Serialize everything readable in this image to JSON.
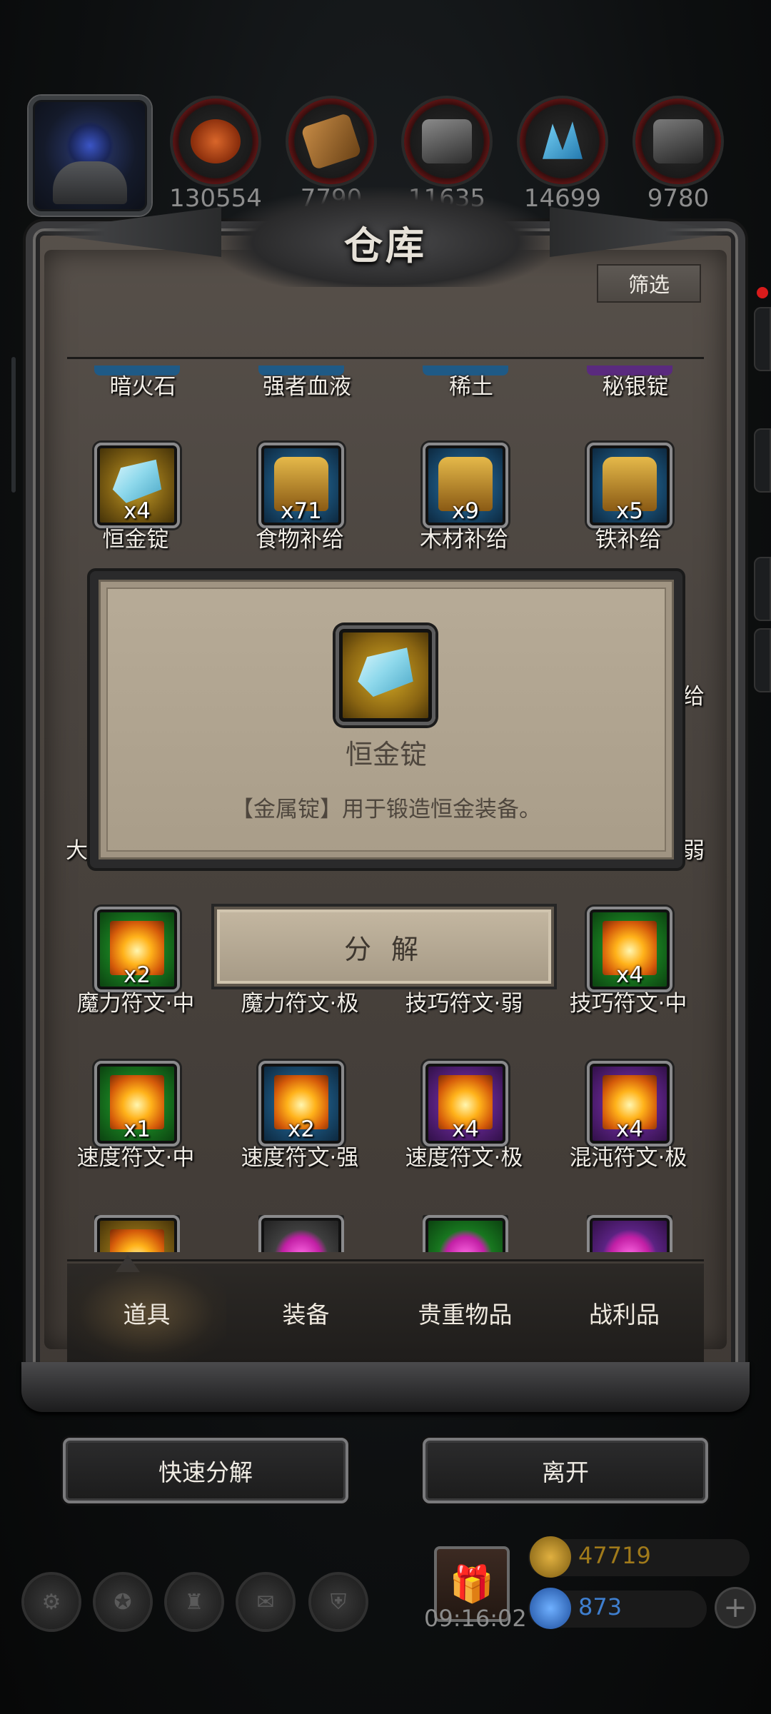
{
  "resources": [
    {
      "icon": "orb-icon",
      "count": "130554",
      "color": "#c24a17"
    },
    {
      "icon": "wood-icon",
      "count": "7790",
      "color": "#9a6a2e"
    },
    {
      "icon": "iron-icon",
      "count": "11635",
      "color": "#6a6a6a"
    },
    {
      "icon": "crystal-icon",
      "count": "14699",
      "color": "#2fa6d8"
    },
    {
      "icon": "steel-icon",
      "count": "9780",
      "color": "#5e5e5e"
    }
  ],
  "panel": {
    "title": "仓库",
    "filter_label": "筛选"
  },
  "rows": {
    "partial_names": [
      "暗火石",
      "强者血液",
      "稀土",
      "秘银锭"
    ],
    "row1": [
      {
        "name": "恒金锭",
        "qty": "x4",
        "rarity": "gold",
        "icon": "ingot-icon"
      },
      {
        "name": "食物补给",
        "qty": "x71",
        "rarity": "blue",
        "icon": "chest-icon"
      },
      {
        "name": "木材补给",
        "qty": "x9",
        "rarity": "blue",
        "icon": "chest-icon"
      },
      {
        "name": "铁补给",
        "qty": "x5",
        "rarity": "blue",
        "icon": "chest-icon"
      }
    ],
    "row2_edges": {
      "left": "大",
      "right_top": "给",
      "right_bottom": "弱"
    },
    "row3": [
      {
        "name": "魔力符文·中",
        "qty": "x2",
        "rarity": "green",
        "icon": "rune-icon"
      },
      {
        "name": "魔力符文·极",
        "qty": "",
        "rarity": "purple",
        "icon": "rune-icon"
      },
      {
        "name": "技巧符文·弱",
        "qty": "",
        "rarity": "gray",
        "icon": "rune-icon"
      },
      {
        "name": "技巧符文·中",
        "qty": "x4",
        "rarity": "green",
        "icon": "rune-icon"
      }
    ],
    "row4": [
      {
        "name": "速度符文·中",
        "qty": "x1",
        "rarity": "green",
        "icon": "rune-icon"
      },
      {
        "name": "速度符文·强",
        "qty": "x2",
        "rarity": "blue",
        "icon": "rune-icon"
      },
      {
        "name": "速度符文·极",
        "qty": "x4",
        "rarity": "purple",
        "icon": "rune-icon"
      },
      {
        "name": "混沌符文·极",
        "qty": "x4",
        "rarity": "purple",
        "icon": "rune-icon"
      }
    ],
    "row5_rarities": [
      "gold",
      "gray",
      "green",
      "purple"
    ]
  },
  "tooltip": {
    "item_name": "恒金锭",
    "description": "【金属锭】用于锻造恒金装备。",
    "action_label": "分 解"
  },
  "tabs": [
    {
      "label": "道具",
      "active": true
    },
    {
      "label": "装备",
      "active": false
    },
    {
      "label": "贵重物品",
      "active": false
    },
    {
      "label": "战利品",
      "active": false
    }
  ],
  "buttons": {
    "quick_decompose": "快速分解",
    "leave": "离开"
  },
  "footer": {
    "timer": "09:16:02",
    "gold": "47719",
    "gems": "873",
    "gold_color": "#b8860b",
    "gem_color": "#3a7fd8"
  }
}
